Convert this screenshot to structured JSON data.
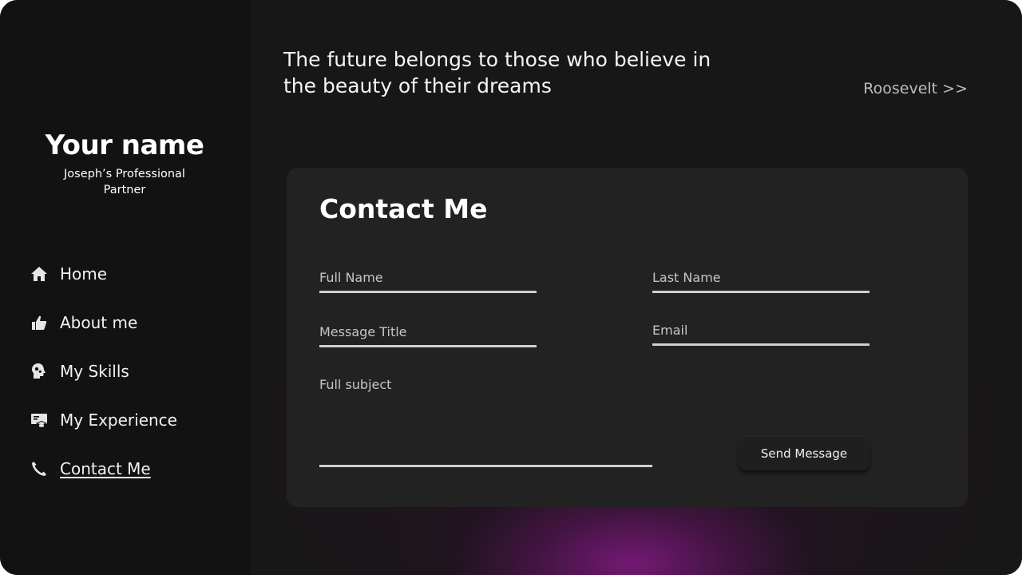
{
  "sidebar": {
    "name": "Your name",
    "subtitle": "Joseph’s Professional Partner",
    "nav": [
      {
        "label": "Home",
        "icon": "home-icon"
      },
      {
        "label": "About me",
        "icon": "thumbs-up-icon"
      },
      {
        "label": "My Skills",
        "icon": "brain-gears-icon"
      },
      {
        "label": "My Experience",
        "icon": "graduation-certificate-icon"
      },
      {
        "label": "Contact Me",
        "icon": "phone-icon",
        "active": true
      }
    ]
  },
  "header": {
    "quote": "The future belongs to those who believe in the beauty of their dreams",
    "author": "Roosevelt >>"
  },
  "contact": {
    "title": "Contact Me",
    "fields": {
      "full_name": "Full Name",
      "last_name": "Last Name",
      "message_title": "Message Title",
      "email": "Email",
      "full_subject": "Full subject"
    },
    "send_label": "Send Message"
  },
  "colors": {
    "background": "#171717",
    "sidebar": "#121212",
    "card": "#222222",
    "accent_glow": "#7a1a7a",
    "underline": "#cfcfcf"
  }
}
